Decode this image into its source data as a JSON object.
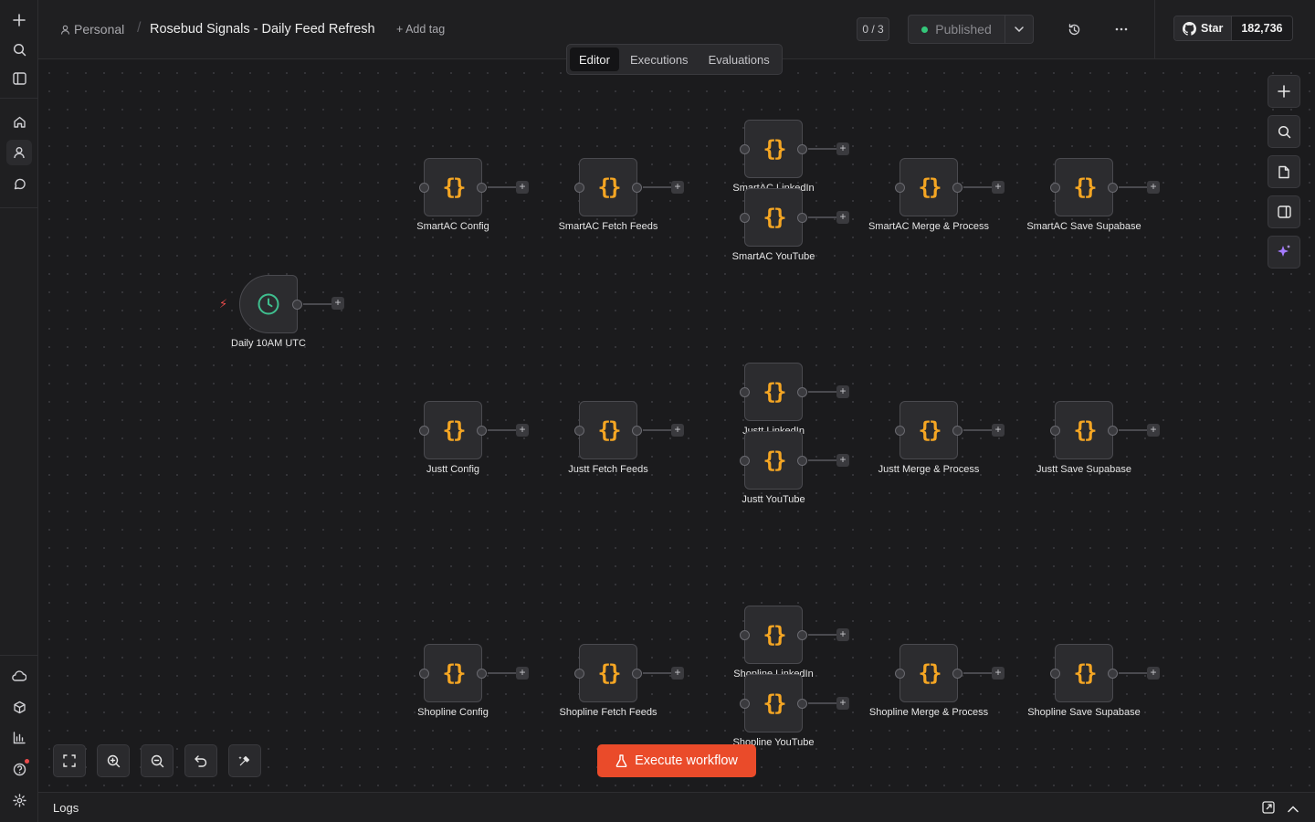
{
  "header": {
    "workspace": "Personal",
    "workflow_title": "Rosebud Signals - Daily Feed Refresh",
    "add_tag_label": "+ Add tag",
    "counter": "0 / 3",
    "publish_label": "Published",
    "github_star_label": "Star",
    "github_star_count": "182,736"
  },
  "tabs": [
    {
      "label": "Editor",
      "active": true
    },
    {
      "label": "Executions",
      "active": false
    },
    {
      "label": "Evaluations",
      "active": false
    }
  ],
  "trigger": {
    "label": "Daily 10AM UTC",
    "icon": "clock-icon"
  },
  "nodes": [
    {
      "id": "smartac-config",
      "label": "SmartAC Config"
    },
    {
      "id": "smartac-fetch",
      "label": "SmartAC Fetch Feeds"
    },
    {
      "id": "smartac-linkedin",
      "label": "SmartAC LinkedIn"
    },
    {
      "id": "smartac-youtube",
      "label": "SmartAC YouTube"
    },
    {
      "id": "smartac-merge",
      "label": "SmartAC Merge & Process"
    },
    {
      "id": "smartac-save",
      "label": "SmartAC Save Supabase"
    },
    {
      "id": "justt-config",
      "label": "Justt Config"
    },
    {
      "id": "justt-fetch",
      "label": "Justt Fetch Feeds"
    },
    {
      "id": "justt-linkedin",
      "label": "Justt LinkedIn"
    },
    {
      "id": "justt-youtube",
      "label": "Justt YouTube"
    },
    {
      "id": "justt-merge",
      "label": "Justt Merge & Process"
    },
    {
      "id": "justt-save",
      "label": "Justt Save Supabase"
    },
    {
      "id": "shopline-config",
      "label": "Shopline Config"
    },
    {
      "id": "shopline-fetch",
      "label": "Shopline Fetch Feeds"
    },
    {
      "id": "shopline-linkedin",
      "label": "Shopline LinkedIn"
    },
    {
      "id": "shopline-youtube",
      "label": "Shopline YouTube"
    },
    {
      "id": "shopline-merge",
      "label": "Shopline Merge & Process"
    },
    {
      "id": "shopline-save",
      "label": "Shopline Save Supabase"
    }
  ],
  "node_glyph": "{}",
  "execute_label": "Execute workflow",
  "logs_label": "Logs",
  "colors": {
    "accent": "#ea4b2a",
    "code_node": "#f5a623",
    "trigger_icon": "#3fbf8f",
    "published_dot": "#34c77a"
  }
}
